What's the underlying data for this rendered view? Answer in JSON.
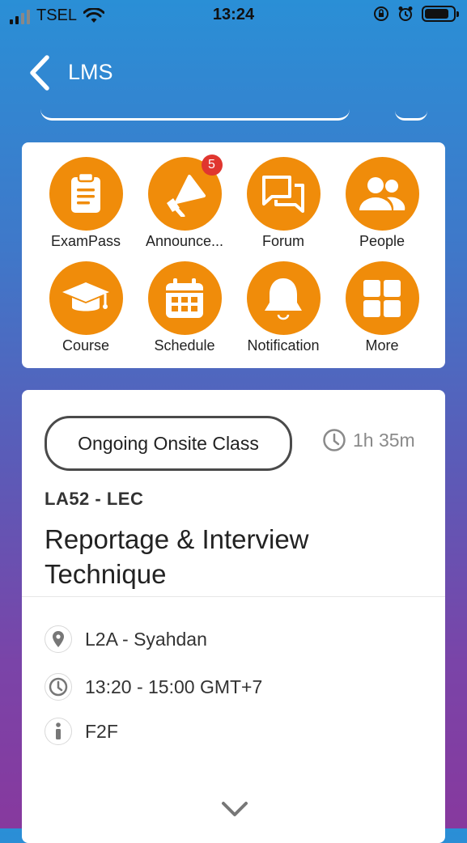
{
  "status_bar": {
    "carrier": "TSEL",
    "time": "13:24"
  },
  "nav": {
    "title": "LMS"
  },
  "menu": {
    "items": [
      {
        "label": "ExamPass",
        "icon": "clipboard-icon"
      },
      {
        "label": "Announce...",
        "icon": "megaphone-icon",
        "badge": "5"
      },
      {
        "label": "Forum",
        "icon": "chat-bubbles-icon"
      },
      {
        "label": "People",
        "icon": "people-icon"
      },
      {
        "label": "Course",
        "icon": "graduation-cap-icon"
      },
      {
        "label": "Schedule",
        "icon": "calendar-icon"
      },
      {
        "label": "Notification",
        "icon": "bell-icon"
      },
      {
        "label": "More",
        "icon": "grid-icon"
      }
    ]
  },
  "class_card": {
    "status": "Ongoing Onsite Class",
    "duration": "1h 35m",
    "code": "LA52 - LEC",
    "title": "Reportage & Interview Technique",
    "location": "L2A - Syahdan",
    "time": "13:20 - 15:00 GMT+7",
    "mode": "F2F"
  },
  "colors": {
    "accent": "#f08c0a",
    "badge": "#e0362f"
  }
}
